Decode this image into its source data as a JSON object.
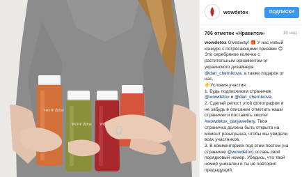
{
  "post": {
    "username": "wowdetox",
    "follow_label": "ПОДПИСКИ",
    "likes": "706 отметок «Нравится»",
    "age": "18 нед.",
    "caption_lines": [
      [
        {
          "t": "wowdetox",
          "k": "u"
        },
        {
          "t": " Giveaway! 🎁 У нас новый",
          "k": ""
        }
      ],
      [
        {
          "t": "конкурс с потрясающими призами 😊",
          "k": ""
        }
      ],
      [
        {
          "t": "Это серебряное колечко с",
          "k": ""
        }
      ],
      [
        {
          "t": "растительным орнаментом от",
          "k": ""
        }
      ],
      [
        {
          "t": "украинского дизайнера",
          "k": ""
        }
      ],
      [
        {
          "t": "@dari_chernikova",
          "k": "tag"
        },
        {
          "t": ", а также подарок от",
          "k": ""
        }
      ],
      [
        {
          "t": "нас.",
          "k": ""
        }
      ],
      [
        {
          "t": "👉Условия участия:",
          "k": ""
        }
      ],
      [
        {
          "t": "1. Будь подписчиком страничек",
          "k": ""
        }
      ],
      [
        {
          "t": "@wowdetox",
          "k": "tag"
        },
        {
          "t": " и ",
          "k": ""
        },
        {
          "t": "@dari_chernikova",
          "k": "tag"
        }
      ],
      [
        {
          "t": "2. Сделай репост этой фотографии и",
          "k": ""
        }
      ],
      [
        {
          "t": "не забудь в описании отметить наши",
          "k": ""
        }
      ],
      [
        {
          "t": "странички и поставить хештег",
          "k": ""
        }
      ],
      [
        {
          "t": "#wowdetox_darijewellery",
          "k": "tag"
        },
        {
          "t": ". Твоя",
          "k": ""
        }
      ],
      [
        {
          "t": "страничка должна быть открыта на",
          "k": ""
        }
      ],
      [
        {
          "t": "момент розыгрыша, чтобы мы увидели",
          "k": ""
        }
      ],
      [
        {
          "t": "всех участников.",
          "k": ""
        }
      ],
      [
        {
          "t": "3. В комментариях под этим постом (на",
          "k": ""
        }
      ],
      [
        {
          "t": "страничке ",
          "k": ""
        },
        {
          "t": "@wowdetox",
          "k": "tag"
        },
        {
          "t": ") оставь свой",
          "k": ""
        }
      ],
      [
        {
          "t": "порядковый номер. Убедись, что твой",
          "k": ""
        }
      ],
      [
        {
          "t": "номер уникален и ты не повторил",
          "k": ""
        }
      ],
      [
        {
          "t": "предыдущий.",
          "k": ""
        }
      ]
    ]
  },
  "bottle_label": "WOW detox",
  "colors": {
    "accent": "#3897f0",
    "hashtag": "#003569",
    "shirt": "#8a8a8a",
    "juice_orange": "#d2703a",
    "juice_green": "#8a8f3c",
    "juice_red": "#a8282c",
    "juice_coral": "#d4543c",
    "logo_red": "#b4342c"
  }
}
